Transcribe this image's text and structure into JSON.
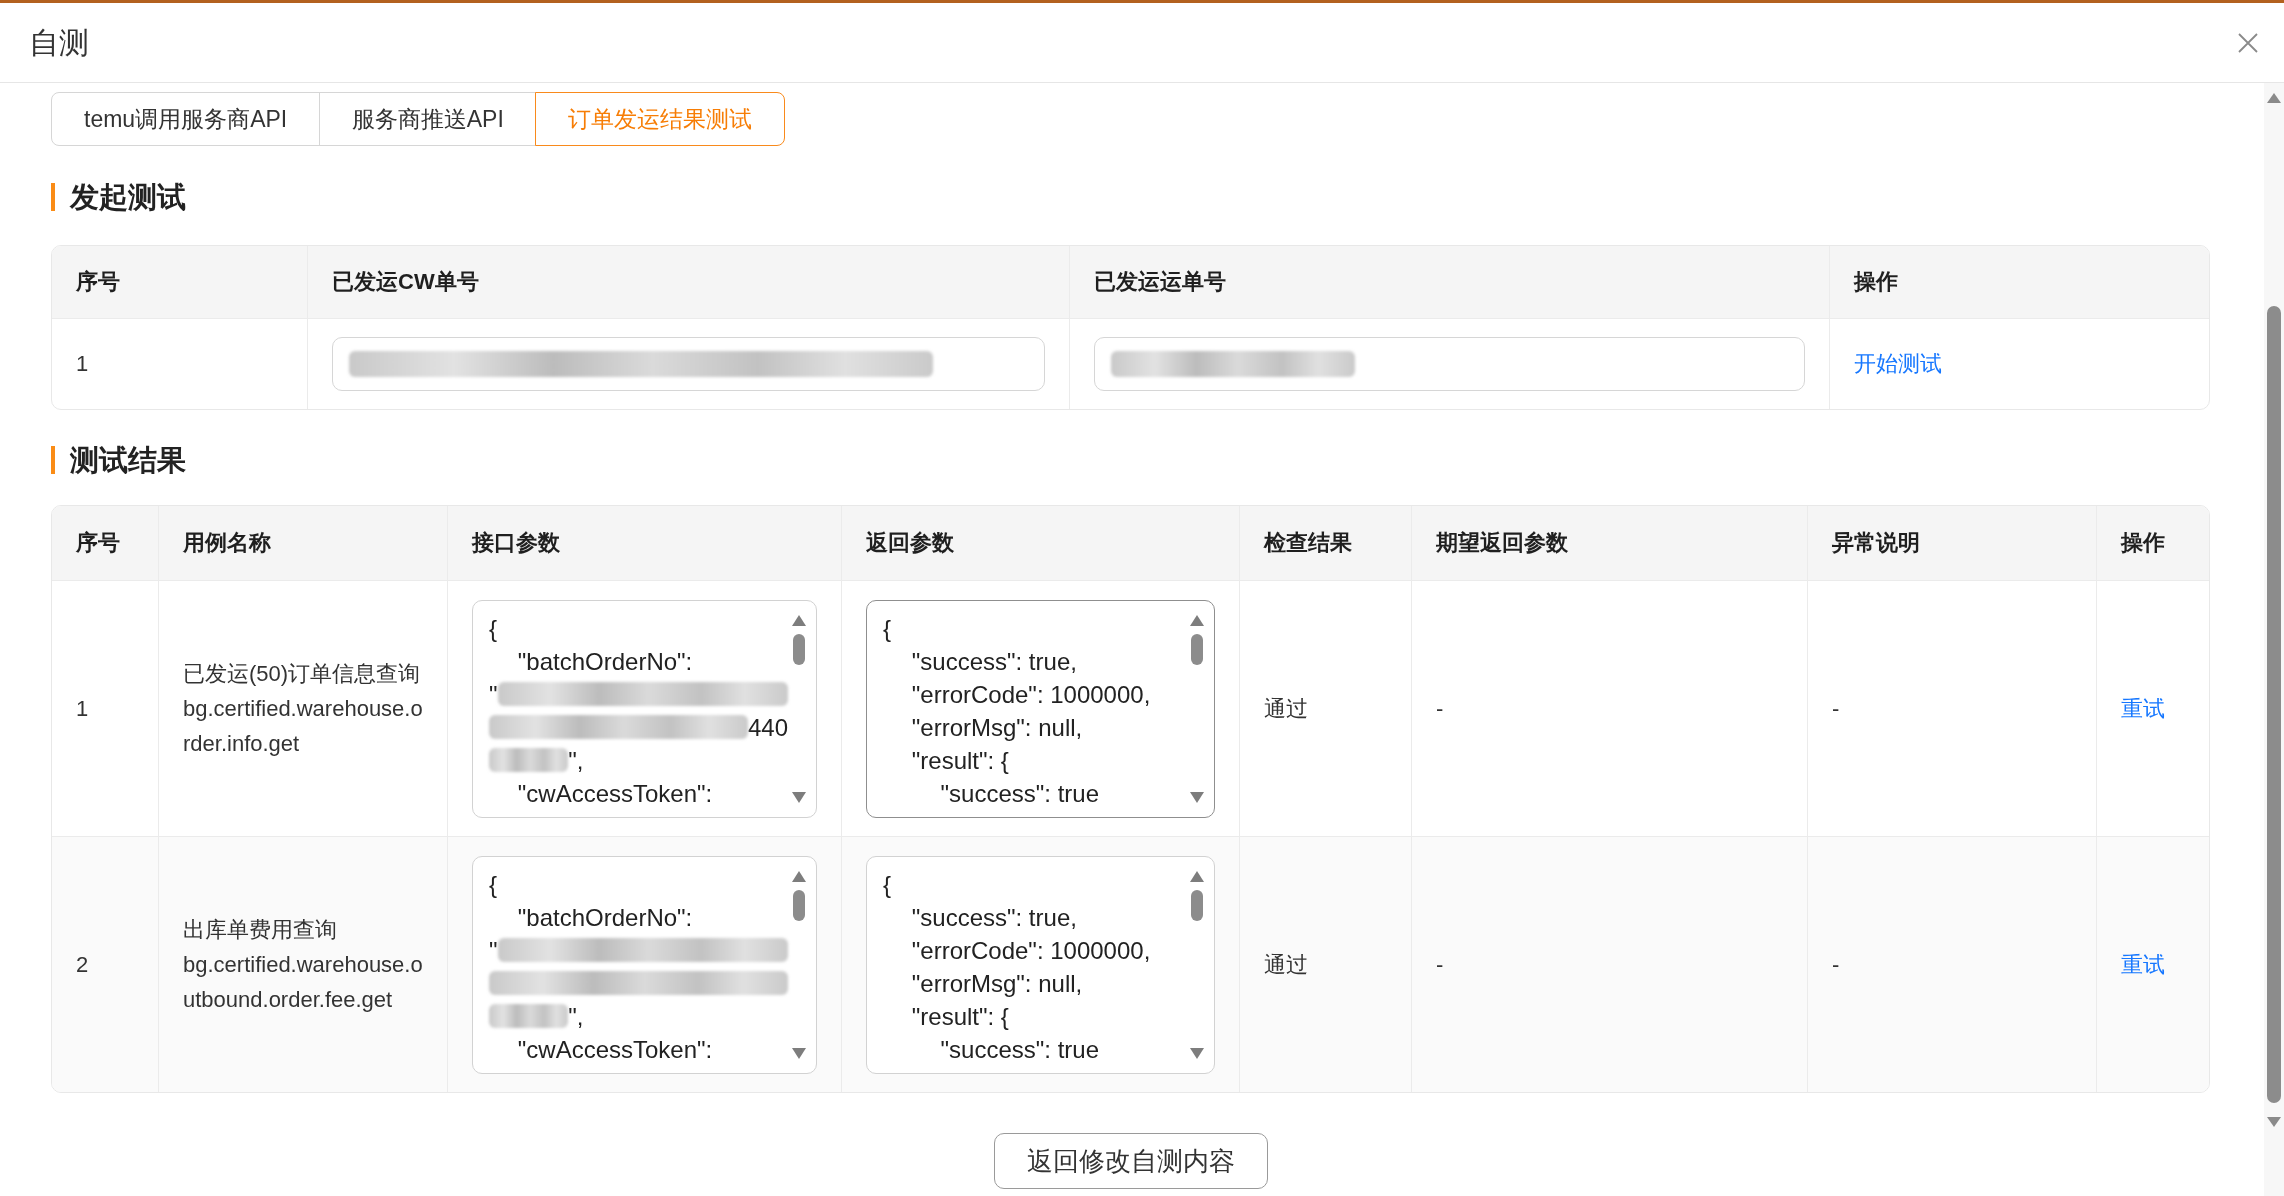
{
  "dialog": {
    "title": "自测"
  },
  "tabs": [
    {
      "label": "temu调用服务商API",
      "selected": false
    },
    {
      "label": "服务商推送API",
      "selected": false
    },
    {
      "label": "订单发运结果测试",
      "selected": true
    }
  ],
  "start_test": {
    "heading": "发起测试",
    "columns": [
      "序号",
      "已发运CW单号",
      "已发运运单号",
      "操作"
    ],
    "rows": [
      {
        "index": "1",
        "cw_order_no": {
          "masked": true
        },
        "waybill_no": {
          "masked": true
        },
        "action": "开始测试"
      }
    ]
  },
  "results": {
    "heading": "测试结果",
    "columns": [
      "序号",
      "用例名称",
      "接口参数",
      "返回参数",
      "检查结果",
      "期望返回参数",
      "异常说明",
      "操作"
    ],
    "rows": [
      {
        "index": "1",
        "case_name": "已发运(50)订单信息查询bg.certified.warehouse.order.info.get",
        "request": {
          "focused": false,
          "lines": [
            {
              "segments": [
                {
                  "kind": "text",
                  "text": "{"
                }
              ],
              "children": [
                {
                  "segments": [
                    {
                      "kind": "text",
                      "text": "\"batchOrderNo\":"
                    }
                  ],
                  "wrapped": [
                    [
                      {
                        "kind": "text",
                        "text": "\""
                      },
                      {
                        "kind": "blur"
                      }
                    ],
                    [
                      {
                        "kind": "blur"
                      },
                      {
                        "kind": "text",
                        "text": "440"
                      }
                    ],
                    [
                      {
                        "kind": "shortblur"
                      },
                      {
                        "kind": "text",
                        "text": "\","
                      }
                    ]
                  ]
                },
                {
                  "segments": [
                    {
                      "kind": "text",
                      "text": "\"cwAccessToken\":"
                    }
                  ]
                }
              ]
            }
          ]
        },
        "response": {
          "focused": true,
          "lines": [
            {
              "segments": [
                {
                  "kind": "text",
                  "text": "{"
                }
              ],
              "children": [
                {
                  "segments": [
                    {
                      "kind": "text",
                      "text": "\"success\": true,"
                    }
                  ]
                },
                {
                  "segments": [
                    {
                      "kind": "text",
                      "text": "\"errorCode\": 1000000,"
                    }
                  ]
                },
                {
                  "segments": [
                    {
                      "kind": "text",
                      "text": "\"errorMsg\": null,"
                    }
                  ]
                },
                {
                  "segments": [
                    {
                      "kind": "text",
                      "text": "\"result\": {"
                    }
                  ],
                  "children": [
                    {
                      "segments": [
                        {
                          "kind": "text",
                          "text": "\"success\": true"
                        }
                      ]
                    }
                  ]
                }
              ]
            }
          ]
        },
        "check_result": "通过",
        "expected": "-",
        "error_note": "-",
        "action": "重试"
      },
      {
        "index": "2",
        "case_name": "出库单费用查询bg.certified.warehouse.outbound.order.fee.get",
        "request": {
          "focused": false,
          "lines": [
            {
              "segments": [
                {
                  "kind": "text",
                  "text": "{"
                }
              ],
              "children": [
                {
                  "segments": [
                    {
                      "kind": "text",
                      "text": "\"batchOrderNo\":"
                    }
                  ],
                  "wrapped": [
                    [
                      {
                        "kind": "text",
                        "text": "\""
                      },
                      {
                        "kind": "blur"
                      }
                    ],
                    [
                      {
                        "kind": "blur"
                      }
                    ],
                    [
                      {
                        "kind": "shortblur"
                      },
                      {
                        "kind": "text",
                        "text": "\","
                      }
                    ]
                  ]
                },
                {
                  "segments": [
                    {
                      "kind": "text",
                      "text": "\"cwAccessToken\":"
                    }
                  ]
                }
              ]
            }
          ]
        },
        "response": {
          "focused": false,
          "lines": [
            {
              "segments": [
                {
                  "kind": "text",
                  "text": "{"
                }
              ],
              "children": [
                {
                  "segments": [
                    {
                      "kind": "text",
                      "text": "\"success\": true,"
                    }
                  ]
                },
                {
                  "segments": [
                    {
                      "kind": "text",
                      "text": "\"errorCode\": 1000000,"
                    }
                  ]
                },
                {
                  "segments": [
                    {
                      "kind": "text",
                      "text": "\"errorMsg\": null,"
                    }
                  ]
                },
                {
                  "segments": [
                    {
                      "kind": "text",
                      "text": "\"result\": {"
                    }
                  ],
                  "children": [
                    {
                      "segments": [
                        {
                          "kind": "text",
                          "text": "\"success\": true"
                        }
                      ]
                    }
                  ]
                }
              ]
            }
          ]
        },
        "check_result": "通过",
        "expected": "-",
        "error_note": "-",
        "action": "重试"
      }
    ]
  },
  "footer": {
    "button": "返回修改自测内容"
  }
}
